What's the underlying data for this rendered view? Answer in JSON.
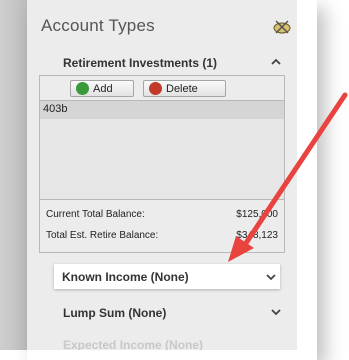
{
  "panel": {
    "title": "Account Types",
    "icon": "piggy-bank-icon"
  },
  "sections": {
    "retirement": {
      "label": "Retirement Investments (1)",
      "add_label": "Add",
      "delete_label": "Delete",
      "items": [
        "403b"
      ],
      "current_total_label": "Current Total Balance:",
      "current_total_value": "$125,000",
      "est_retire_label": "Total Est. Retire Balance:",
      "est_retire_value": "$348,123"
    },
    "known_income": {
      "label": "Known Income (None)"
    },
    "lump_sum": {
      "label": "Lump Sum (None)"
    },
    "next": {
      "label": "Expected Income (None)"
    }
  },
  "colors": {
    "annotation_arrow": "#e8433f",
    "add_icon": "#3a9a3a",
    "delete_icon": "#c0392b"
  }
}
